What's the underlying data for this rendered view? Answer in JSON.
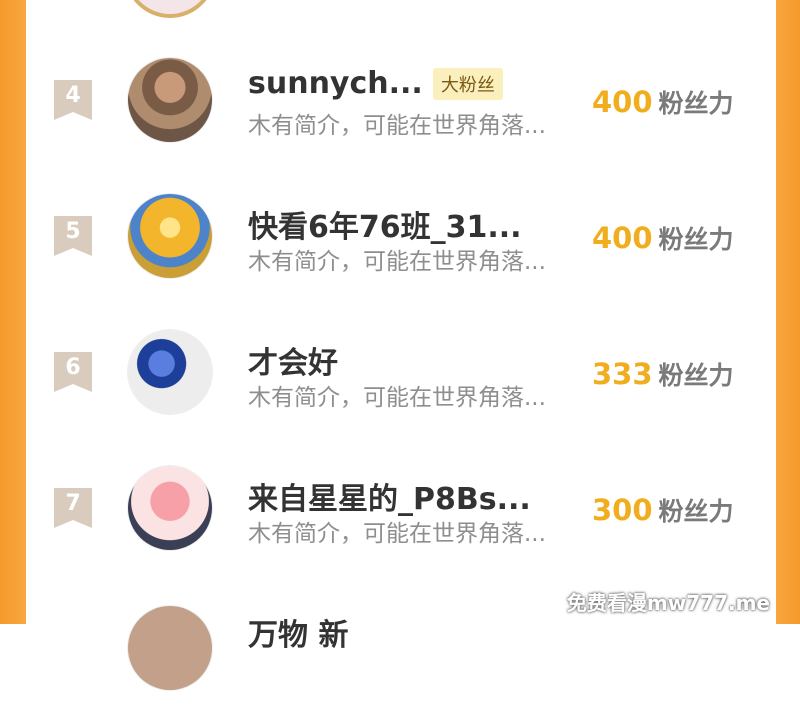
{
  "description_default": "木有简介，可能在世界角落...",
  "fans_label": "粉丝力",
  "rows": [
    {
      "rank": "4",
      "name": "sunnych...",
      "badge": "大粉丝",
      "description": "木有简介，可能在世界角落...",
      "fans": "400",
      "avatar_icon": "boy-photo-avatar"
    },
    {
      "rank": "5",
      "name": "快看6年76班_31...",
      "badge": "",
      "description": "木有简介，可能在世界角落...",
      "fans": "400",
      "avatar_icon": "autumn-trees-avatar"
    },
    {
      "rank": "6",
      "name": "才会好",
      "badge": "",
      "description": "木有简介，可能在世界角落...",
      "fans": "333",
      "avatar_icon": "ultraman-avatar"
    },
    {
      "rank": "7",
      "name": "来自星星的_P8Bs...",
      "badge": "",
      "description": "木有简介，可能在世界角落...",
      "fans": "300",
      "avatar_icon": "cartoon-face-avatar"
    },
    {
      "rank": "",
      "name": "万物 新",
      "badge": "",
      "description": "",
      "fans": "",
      "avatar_icon": "partial-avatar"
    }
  ],
  "watermark": "免费看漫mw777.me",
  "colors": {
    "accent": "#f0ae1e",
    "edge": "#f59a2b",
    "rank_bg": "#d9cbbd",
    "badge_bg": "#fcefbe"
  }
}
